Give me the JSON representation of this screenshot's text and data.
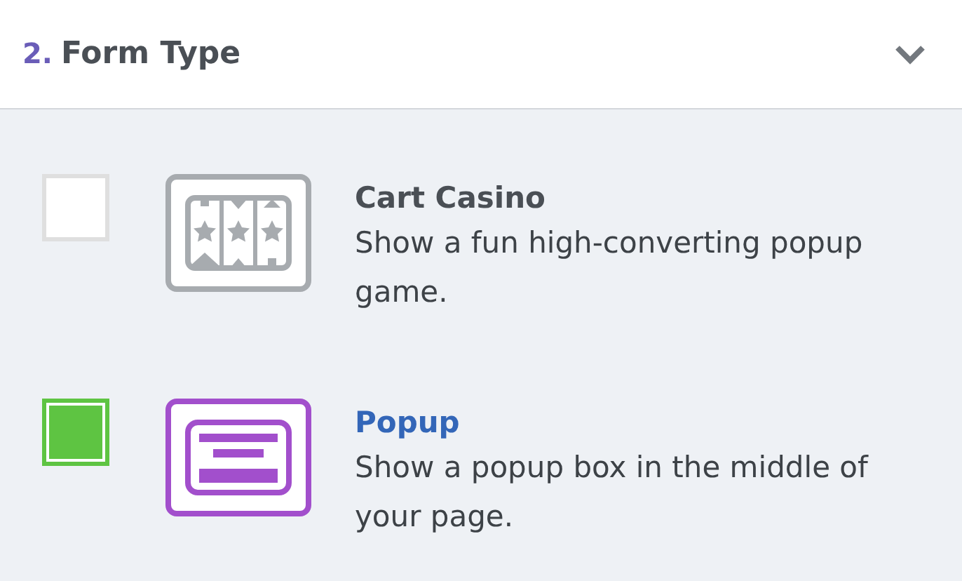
{
  "section": {
    "number": "2.",
    "title": "Form Type",
    "expanded": true
  },
  "options": [
    {
      "kind": "slot-machine",
      "title": "Cart Casino",
      "description": "Show a fun high-converting popup game.",
      "selected": false
    },
    {
      "kind": "popup",
      "title": "Popup",
      "description": "Show a popup box in the middle of your page.",
      "selected": true
    }
  ]
}
